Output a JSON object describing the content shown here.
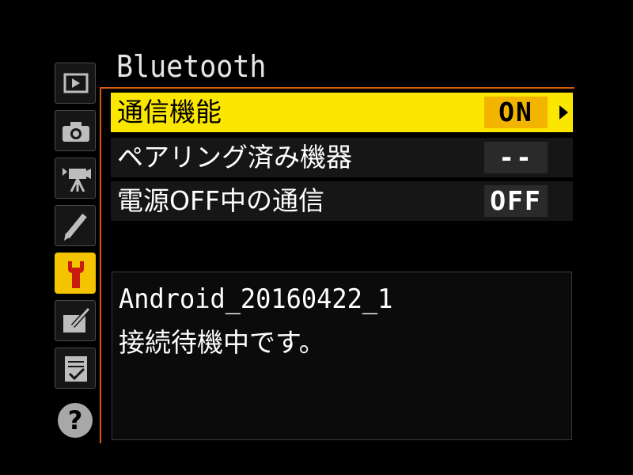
{
  "title": "Bluetooth",
  "menu_tabs": [
    {
      "icon": "playback-icon"
    },
    {
      "icon": "camera-icon"
    },
    {
      "icon": "movie-camera-icon"
    },
    {
      "icon": "pencil-icon"
    },
    {
      "icon": "wrench-icon",
      "active": true
    },
    {
      "icon": "retouch-icon"
    },
    {
      "icon": "my-menu-icon"
    }
  ],
  "help_label": "?",
  "rows": [
    {
      "label": "通信機能",
      "value": "ON",
      "selected": true
    },
    {
      "label": "ペアリング済み機器",
      "value": "--"
    },
    {
      "label": "電源OFF中の通信",
      "value": "OFF"
    }
  ],
  "info": {
    "device": "Android_20160422_1",
    "status": "接続待機中です。"
  },
  "colors": {
    "highlight": "#fbe600",
    "value_highlight": "#f3b400",
    "active_tab": "#f5c400",
    "frame": "#d65a10"
  }
}
